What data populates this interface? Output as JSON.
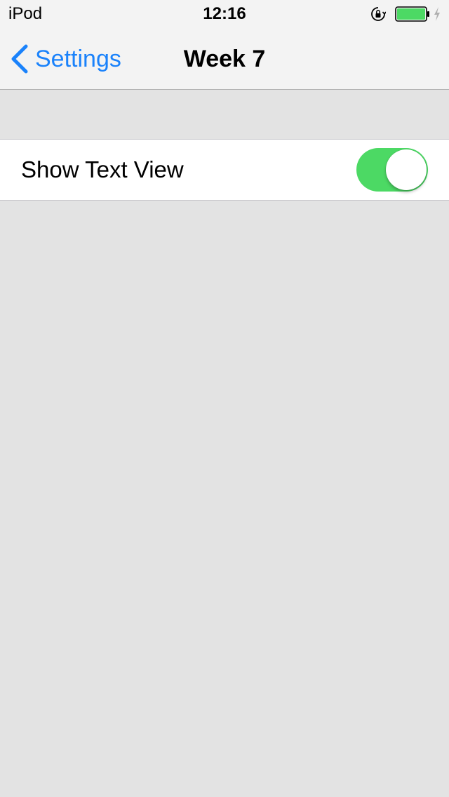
{
  "status_bar": {
    "carrier": "iPod",
    "time": "12:16",
    "battery_level": 1.0,
    "battery_color": "#4cd964",
    "icons": [
      "rotation-lock-icon",
      "battery-icon",
      "charging-icon"
    ]
  },
  "nav": {
    "back_label": "Settings",
    "title": "Week 7",
    "accent_color": "#1a82fb"
  },
  "settings": {
    "rows": [
      {
        "label": "Show Text View",
        "toggle_on": true,
        "toggle_color": "#4cd964"
      }
    ]
  }
}
